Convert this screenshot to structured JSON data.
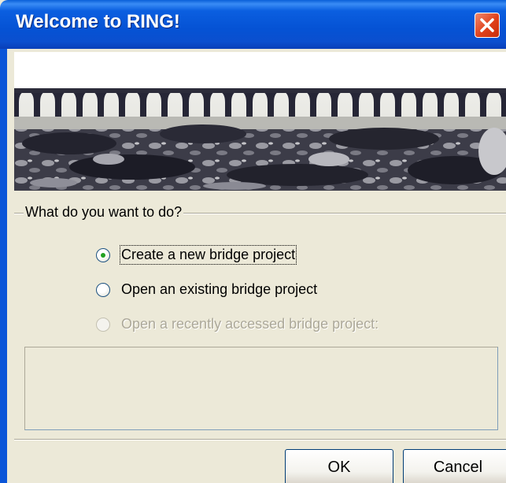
{
  "window": {
    "title": "Welcome to RING!",
    "close_icon": "close-icon",
    "accent": "#0a54d6",
    "close_color": "#e0401a"
  },
  "group": {
    "legend": "What do you want to do?",
    "options": [
      {
        "label": "Create a new bridge project",
        "selected": true,
        "enabled": true
      },
      {
        "label": "Open an existing bridge project",
        "selected": false,
        "enabled": true
      },
      {
        "label": "Open a recently accessed bridge project:",
        "selected": false,
        "enabled": false
      }
    ]
  },
  "buttons": {
    "ok": "OK",
    "cancel": "Cancel"
  }
}
